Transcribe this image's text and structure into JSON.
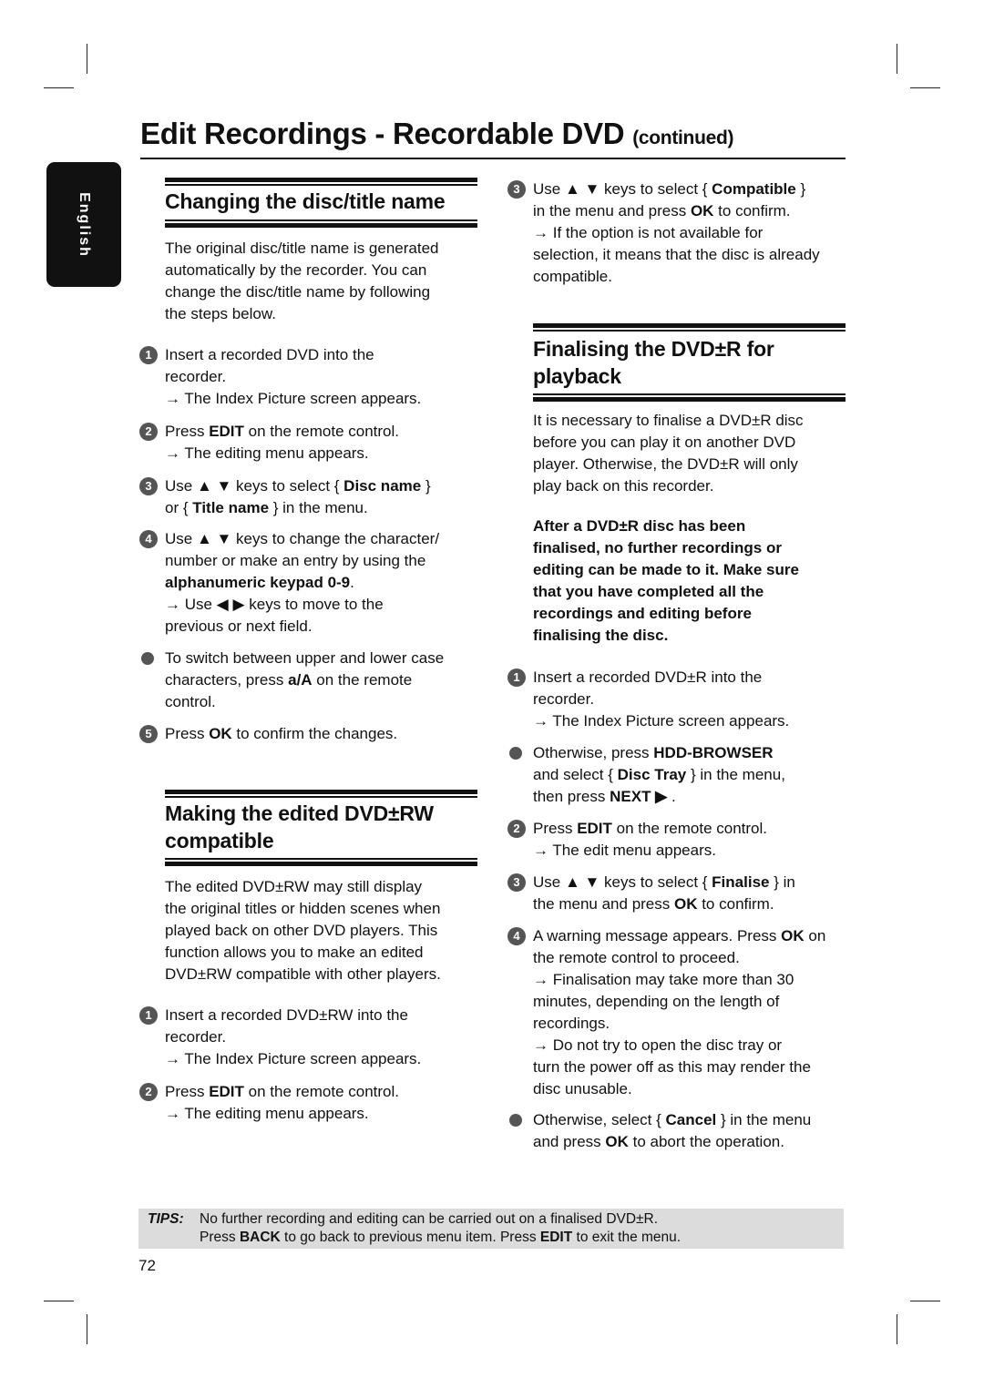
{
  "page": {
    "title": "Edit Recordings - Recordable DVD",
    "title_suffix": "(continued)",
    "language_tab": "English",
    "page_number": "72"
  },
  "left": {
    "heading1": "Changing the disc/title name",
    "intro1": [
      "The original disc/title name is generated",
      "automatically by the recorder. You can",
      "change the disc/title name by following",
      "the steps below."
    ],
    "s1": {
      "num": "1",
      "lines": [
        "Insert a recorded DVD into the",
        "recorder.",
        "→ The Index Picture screen appears."
      ]
    },
    "s2": {
      "num": "2",
      "lines": [
        [
          [
            "Press ",
            0
          ],
          [
            "EDIT",
            1
          ],
          [
            " on the remote control.",
            0
          ]
        ],
        "→ The editing menu appears."
      ]
    },
    "s3": {
      "num": "3",
      "lines": [
        [
          [
            "Use ▲ ▼ keys to select { ",
            0
          ],
          [
            "Disc name",
            1
          ],
          [
            " }",
            0
          ]
        ],
        [
          [
            "or { ",
            0
          ],
          [
            "Title name",
            1
          ],
          [
            " } in the menu.",
            0
          ]
        ]
      ]
    },
    "s4": {
      "num": "4",
      "lines": [
        "Use ▲ ▼ keys to change the character/",
        "number or make an entry by using the",
        [
          [
            "alphanumeric keypad 0-9",
            1
          ],
          [
            ".",
            0
          ]
        ],
        "→ Use ◀ ▶ keys to move to the",
        "previous or next field."
      ]
    },
    "b1": {
      "lines": [
        "To switch between upper and lower case",
        [
          [
            "characters, press ",
            0
          ],
          [
            "a/A",
            1
          ],
          [
            " on the remote",
            0
          ]
        ],
        "control."
      ]
    },
    "s5": {
      "num": "5",
      "lines": [
        [
          [
            "Press ",
            0
          ],
          [
            "OK",
            1
          ],
          [
            " to confirm the changes.",
            0
          ]
        ]
      ]
    },
    "heading2": [
      "Making the edited DVD±RW",
      "compatible"
    ],
    "intro2": [
      "The edited DVD±RW may still display",
      "the original titles or hidden scenes when",
      "played back on other DVD players. This",
      "function allows you to make an edited",
      "DVD±RW compatible with other players."
    ],
    "t1": {
      "num": "1",
      "lines": [
        "Insert a recorded DVD±RW into the",
        "recorder.",
        "→ The Index Picture screen appears."
      ]
    },
    "t2": {
      "num": "2",
      "lines": [
        [
          [
            "Press ",
            0
          ],
          [
            "EDIT",
            1
          ],
          [
            " on the remote control.",
            0
          ]
        ],
        "→ The editing menu appears."
      ]
    }
  },
  "right": {
    "t3": {
      "num": "3",
      "lines": [
        [
          [
            "Use ▲ ▼ keys to select { ",
            0
          ],
          [
            "Compatible",
            1
          ],
          [
            " }",
            0
          ]
        ],
        [
          [
            "in the menu and press ",
            0
          ],
          [
            "OK",
            1
          ],
          [
            " to confirm.",
            0
          ]
        ],
        "→ If the option is not available for",
        "selection, it means that the disc is already",
        "compatible."
      ]
    },
    "heading3": [
      "Finalising the DVD±R for",
      "playback"
    ],
    "intro3": [
      "It is necessary to finalise a DVD±R disc",
      "before you can play it on another DVD",
      "player. Otherwise, the DVD±R will only",
      "play back on this recorder."
    ],
    "warning": [
      [
        [
          "After a DVD±R disc has been",
          1
        ]
      ],
      [
        [
          "finalised, no further recordings or",
          1
        ]
      ],
      [
        [
          "editing can be made to it. Make sure",
          1
        ]
      ],
      [
        [
          "that you have completed all the",
          1
        ]
      ],
      [
        [
          "recordings and editing before",
          1
        ]
      ],
      [
        [
          "finalising the disc.",
          1
        ]
      ]
    ],
    "f1": {
      "num": "1",
      "lines": [
        "Insert a recorded DVD±R into the",
        "recorder.",
        "→ The Index Picture screen appears."
      ]
    },
    "fb1": {
      "lines": [
        [
          [
            "Otherwise, press ",
            0
          ],
          [
            "HDD-BROWSER",
            1
          ]
        ],
        [
          [
            "and select { ",
            0
          ],
          [
            "Disc Tray",
            1
          ],
          [
            " } in the menu,",
            0
          ]
        ],
        [
          [
            "then press ",
            0
          ],
          [
            "NEXT ▶",
            1
          ],
          [
            " .",
            0
          ]
        ]
      ]
    },
    "f2": {
      "num": "2",
      "lines": [
        [
          [
            "Press ",
            0
          ],
          [
            "EDIT",
            1
          ],
          [
            " on the remote control.",
            0
          ]
        ],
        "→ The edit menu appears."
      ]
    },
    "f3": {
      "num": "3",
      "lines": [
        [
          [
            "Use ▲ ▼ keys to select { ",
            0
          ],
          [
            "Finalise",
            1
          ],
          [
            " } in",
            0
          ]
        ],
        [
          [
            "the menu and press ",
            0
          ],
          [
            "OK",
            1
          ],
          [
            " to confirm.",
            0
          ]
        ]
      ]
    },
    "f4": {
      "num": "4",
      "lines": [
        [
          [
            "A warning message appears. Press ",
            0
          ],
          [
            "OK",
            1
          ],
          [
            " on",
            0
          ]
        ],
        "the remote control to proceed.",
        "→ Finalisation may take more than 30",
        "minutes, depending on the length of",
        "recordings.",
        "→ Do not try to open the disc tray or",
        "turn the power off as this may render the",
        "disc unusable."
      ]
    },
    "fb2": {
      "lines": [
        [
          [
            "Otherwise, select { ",
            0
          ],
          [
            "Cancel",
            1
          ],
          [
            " } in the menu",
            0
          ]
        ],
        [
          [
            "and press ",
            0
          ],
          [
            "OK",
            1
          ],
          [
            " to abort the operation.",
            0
          ]
        ]
      ]
    }
  },
  "tips": {
    "label": "TIPS:",
    "line1": [
      [
        "No further recording and editing can be carried out on a finalised DVD±R.",
        0
      ]
    ],
    "line2": [
      [
        "Press ",
        0
      ],
      [
        "BACK",
        1
      ],
      [
        " to go back to previous menu item. Press ",
        0
      ],
      [
        "EDIT",
        1
      ],
      [
        " to exit the menu.",
        0
      ]
    ]
  },
  "colors": {
    "step_icon": "#555555",
    "tips_bg": "#dcdcdc",
    "tab_bg": "#111111"
  }
}
